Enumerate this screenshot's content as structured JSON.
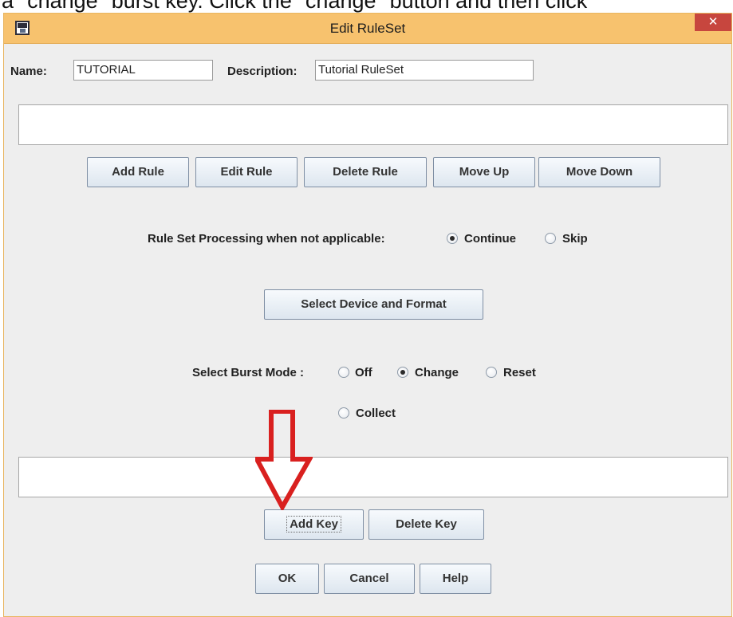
{
  "caption": {
    "text": "a \"change\" burst key. Click the \"change\" button and then click"
  },
  "window": {
    "title": "Edit RuleSet",
    "close_glyph": "✕"
  },
  "name_field": {
    "label": "Name:",
    "value": "TUTORIAL"
  },
  "description_field": {
    "label": "Description:",
    "value": "Tutorial RuleSet"
  },
  "rule_buttons": {
    "add": "Add Rule",
    "edit": "Edit Rule",
    "delete": "Delete Rule",
    "move_up": "Move Up",
    "move_down": "Move Down"
  },
  "processing": {
    "label": "Rule Set Processing when not applicable:",
    "options": [
      {
        "label": "Continue",
        "checked": true
      },
      {
        "label": "Skip",
        "checked": false
      }
    ]
  },
  "select_device_button": "Select Device and Format",
  "burst_mode": {
    "label": "Select Burst Mode :",
    "options": [
      {
        "label": "Off",
        "checked": false
      },
      {
        "label": "Change",
        "checked": true
      },
      {
        "label": "Reset",
        "checked": false
      },
      {
        "label": "Collect",
        "checked": false
      }
    ]
  },
  "key_buttons": {
    "add": "Add Key",
    "delete": "Delete Key"
  },
  "dialog_buttons": {
    "ok": "OK",
    "cancel": "Cancel",
    "help": "Help"
  },
  "annotation": {
    "icon": "down-arrow-icon",
    "color": "#d9201f"
  },
  "colors": {
    "titlebar": "#f7c26e",
    "window_bg": "#eeeeee",
    "close": "#c7463e"
  }
}
